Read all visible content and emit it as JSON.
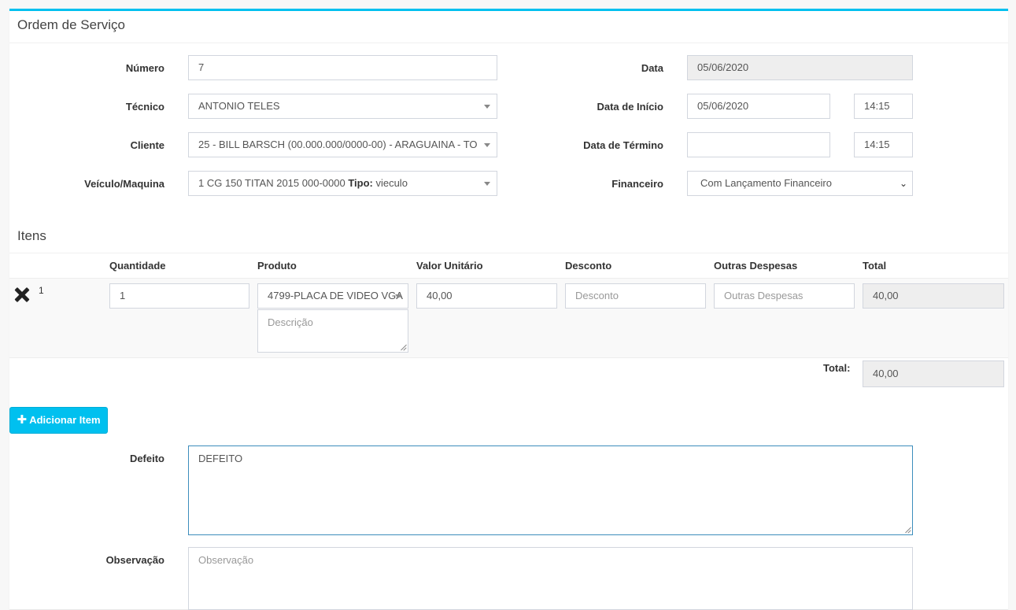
{
  "box": {
    "title": "Ordem de Serviço"
  },
  "form": {
    "numero": {
      "label": "Número",
      "value": "7"
    },
    "tecnico": {
      "label": "Técnico",
      "value": "ANTONIO TELES"
    },
    "cliente": {
      "label": "Cliente",
      "value": "25 - BILL BARSCH (00.000.000/0000-00) - ARAGUAINA - TO"
    },
    "veiculo": {
      "label": "Veículo/Maquina",
      "value_prefix": "1 CG 150 TITAN 2015 000-0000 ",
      "tipo_label": "Tipo:",
      "tipo_value": " vieculo"
    },
    "data": {
      "label": "Data",
      "value": "05/06/2020"
    },
    "data_inicio": {
      "label": "Data de Início",
      "date": "05/06/2020",
      "time": "14:15"
    },
    "data_termino": {
      "label": "Data de Término",
      "date": "",
      "time": "14:15"
    },
    "financeiro": {
      "label": "Financeiro",
      "value": "Com Lançamento Financeiro"
    }
  },
  "itens": {
    "title": "Itens",
    "columns": [
      "Quantidade",
      "Produto",
      "Valor Unitário",
      "Desconto",
      "Outras Despesas",
      "Total"
    ],
    "rows": [
      {
        "index": "1",
        "quantidade": "1",
        "produto": "4799-PLACA DE VIDEO VGA",
        "descricao_placeholder": "Descrição",
        "valor_unitario": "40,00",
        "desconto_placeholder": "Desconto",
        "outras_despesas_placeholder": "Outras Despesas",
        "total": "40,00"
      }
    ],
    "total_label": "Total:",
    "total_value": "40,00",
    "add_button": "Adicionar Item"
  },
  "defeito": {
    "label": "Defeito",
    "value": "DEFEITO"
  },
  "observacao": {
    "label": "Observação",
    "placeholder": "Observação"
  },
  "colors": {
    "accent": "#00c0ef",
    "readonly_bg": "#eeeeee",
    "focus_border": "#3c8dbc"
  }
}
